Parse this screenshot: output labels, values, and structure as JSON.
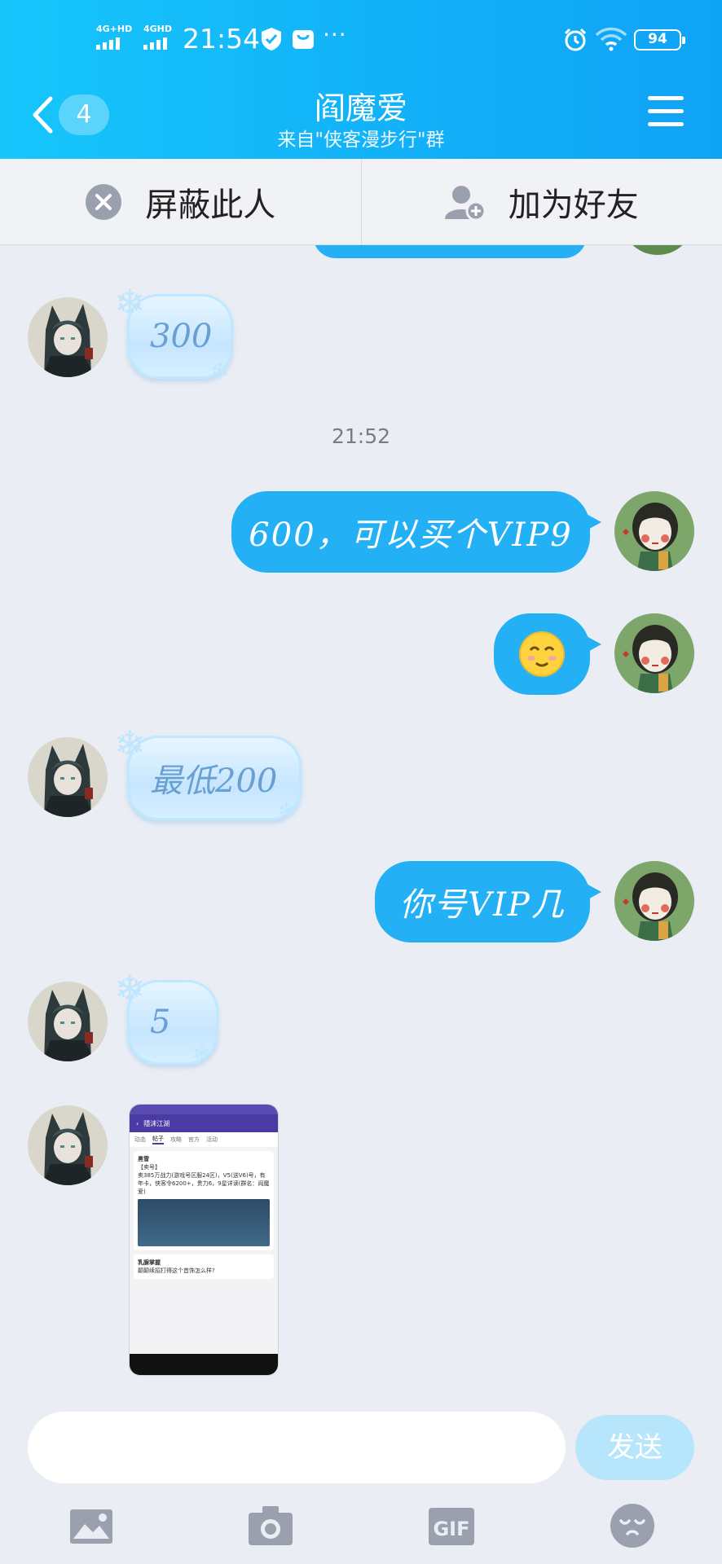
{
  "status_bar": {
    "signal1": "4G+HD",
    "signal2": "4GHD",
    "time": "21:54",
    "more": "···",
    "battery": "94"
  },
  "header": {
    "back_count": "4",
    "title": "阎魔爱",
    "subtitle": "来自\"侠客漫步行\"群"
  },
  "actions": {
    "block": "屏蔽此人",
    "add_friend": "加为好友"
  },
  "messages": {
    "m1": "300",
    "time1": "21:52",
    "m2": "600，可以买个VIP9",
    "m3_icon": "smile-emoji",
    "m4": "最低200",
    "m5": "你号VIP几",
    "m6": "5",
    "m7_image": {
      "app_title": "隱沫江湖",
      "tabs": [
        "动态",
        "帖子",
        "攻略",
        "官方",
        "活动"
      ],
      "post_user": "黑雪",
      "post_title": "【卖号】",
      "post_text": "卖385万战力(游戏号区服24区)，V5(送V6)号，有年卡，侠客令6200+，贵力6，9星详读(群名：阎魔爱)",
      "comment_user": "乳腺掌握",
      "comment_text": "颠颠续招打得这个首饰怎么样?"
    }
  },
  "composer": {
    "placeholder": "",
    "send": "发送"
  },
  "toolbar": [
    "image-icon",
    "camera-icon",
    "gif-icon",
    "emoji-icon"
  ],
  "colors": {
    "header": "#12b1f8",
    "out_bubble": "#24b0f5",
    "send_disabled": "#b7e6fc"
  }
}
